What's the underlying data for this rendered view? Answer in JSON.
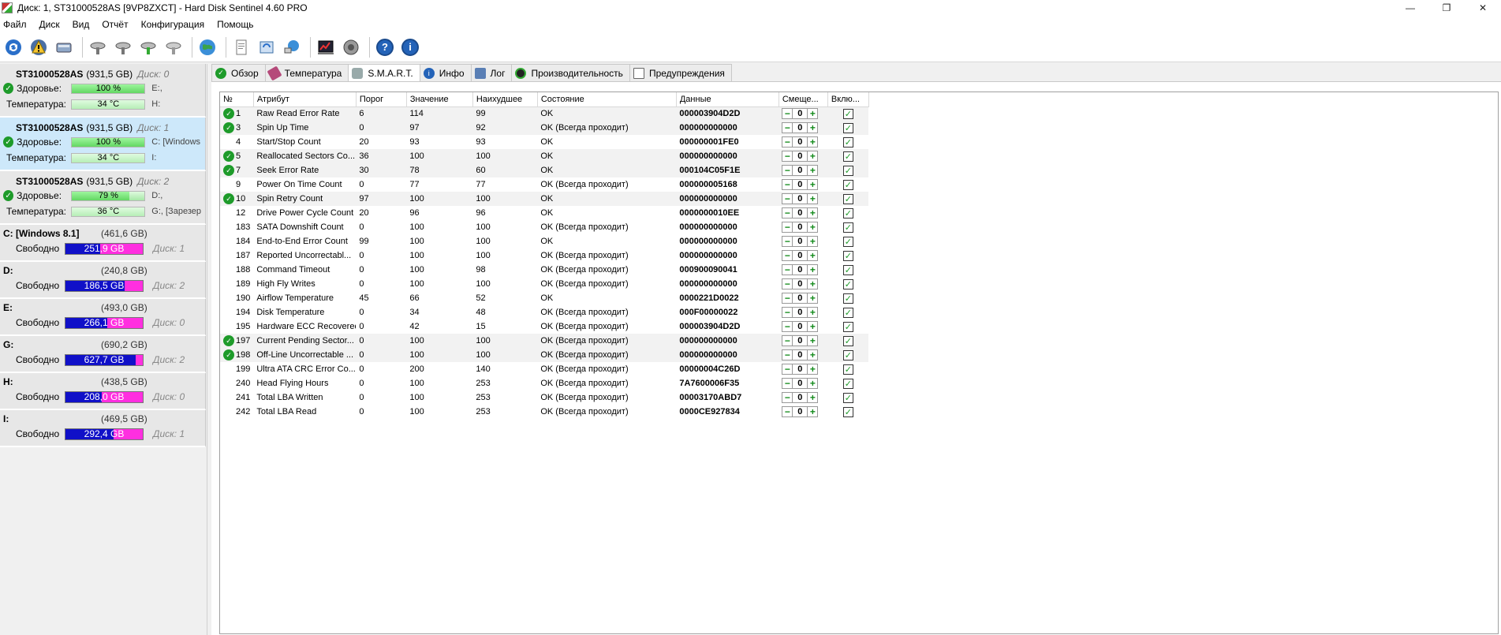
{
  "window": {
    "title": "Диск: 1, ST31000528AS [9VP8ZXCT]  -  Hard Disk Sentinel 4.60 PRO",
    "minimize": "—",
    "restore": "❐",
    "close": "✕"
  },
  "menu": [
    "Файл",
    "Диск",
    "Вид",
    "Отчёт",
    "Конфигурация",
    "Помощь"
  ],
  "toolbar": {
    "icons": [
      "refresh-icon",
      "alert-icon",
      "disk-icon",
      "disk-test-icon",
      "disk-test-icon",
      "disk-test-icon",
      "disk-test-icon",
      "globe-icon",
      "report-icon",
      "send-icon",
      "network-icon",
      "benchmark-icon",
      "sound-icon",
      "help-icon",
      "info-icon"
    ],
    "help_glyph": "?",
    "info_glyph": "i"
  },
  "disks": [
    {
      "model": "ST31000528AS",
      "capacity": "(931,5 GB)",
      "disk_no": "Диск: 0",
      "health_label": "Здоровье:",
      "health": "100 %",
      "health_value": 100,
      "vol1": "E:,",
      "temp_label": "Температура:",
      "temp": "34 °C",
      "vol2": "H:"
    },
    {
      "model": "ST31000528AS",
      "capacity": "(931,5 GB)",
      "disk_no": "Диск: 1",
      "health_label": "Здоровье:",
      "health": "100 %",
      "health_value": 100,
      "vol1": "C: [Windows",
      "temp_label": "Температура:",
      "temp": "34 °C",
      "vol2": "I:"
    },
    {
      "model": "ST31000528AS",
      "capacity": "(931,5 GB)",
      "disk_no": "Диск: 2",
      "health_label": "Здоровье:",
      "health": "79 %",
      "health_value": 79,
      "vol1": "D:,",
      "temp_label": "Температура:",
      "temp": "36 °C",
      "vol2": "G:, [Зарезер"
    }
  ],
  "volumes": [
    {
      "letter": "C: [Windows 8.1]",
      "size": "(461,6 GB)",
      "free_label": "Свободно",
      "free": "251,9 GB",
      "free_fraction": 0.55,
      "disk": "Диск: 1"
    },
    {
      "letter": "D:",
      "size": "(240,8 GB)",
      "free_label": "Свободно",
      "free": "186,5 GB",
      "free_fraction": 0.23,
      "disk": "Диск: 2"
    },
    {
      "letter": "E:",
      "size": "(493,0 GB)",
      "free_label": "Свободно",
      "free": "266,1 GB",
      "free_fraction": 0.46,
      "disk": "Диск: 0"
    },
    {
      "letter": "G:",
      "size": "(690,2 GB)",
      "free_label": "Свободно",
      "free": "627,7 GB",
      "free_fraction": 0.09,
      "disk": "Диск: 2"
    },
    {
      "letter": "H:",
      "size": "(438,5 GB)",
      "free_label": "Свободно",
      "free": "208,0 GB",
      "free_fraction": 0.53,
      "disk": "Диск: 0"
    },
    {
      "letter": "I:",
      "size": "(469,5 GB)",
      "free_label": "Свободно",
      "free": "292,4 GB",
      "free_fraction": 0.38,
      "disk": "Диск: 1"
    }
  ],
  "tabs": [
    {
      "label": "Обзор",
      "icon": "ok-check-icon",
      "active": false
    },
    {
      "label": "Температура",
      "icon": "thermometer-icon",
      "active": false
    },
    {
      "label": "S.M.A.R.T.",
      "icon": "disk-icon",
      "active": true
    },
    {
      "label": "Инфо",
      "icon": "info-icon",
      "active": false
    },
    {
      "label": "Лог",
      "icon": "log-icon",
      "active": false
    },
    {
      "label": "Производительность",
      "icon": "performance-icon",
      "active": false
    },
    {
      "label": "Предупреждения",
      "icon": "warning-doc-icon",
      "active": false
    }
  ],
  "smart": {
    "headers": [
      "№",
      "Атрибут",
      "Порог",
      "Значение",
      "Наихудшее",
      "Состояние",
      "Данные",
      "Смеще...",
      "Вклю..."
    ],
    "rows": [
      {
        "ok": true,
        "id": "1",
        "attr": "Raw Read Error Rate",
        "thr": "6",
        "val": "114",
        "worst": "99",
        "state": "OK",
        "data": "000003904D2D",
        "offset": "0"
      },
      {
        "ok": true,
        "id": "3",
        "attr": "Spin Up Time",
        "thr": "0",
        "val": "97",
        "worst": "92",
        "state": "OK (Всегда проходит)",
        "data": "000000000000",
        "offset": "0"
      },
      {
        "ok": false,
        "id": "4",
        "attr": "Start/Stop Count",
        "thr": "20",
        "val": "93",
        "worst": "93",
        "state": "OK",
        "data": "000000001FE0",
        "offset": "0"
      },
      {
        "ok": true,
        "id": "5",
        "attr": "Reallocated Sectors Co...",
        "thr": "36",
        "val": "100",
        "worst": "100",
        "state": "OK",
        "data": "000000000000",
        "offset": "0"
      },
      {
        "ok": true,
        "id": "7",
        "attr": "Seek Error Rate",
        "thr": "30",
        "val": "78",
        "worst": "60",
        "state": "OK",
        "data": "000104C05F1E",
        "offset": "0"
      },
      {
        "ok": false,
        "id": "9",
        "attr": "Power On Time Count",
        "thr": "0",
        "val": "77",
        "worst": "77",
        "state": "OK (Всегда проходит)",
        "data": "000000005168",
        "offset": "0"
      },
      {
        "ok": true,
        "id": "10",
        "attr": "Spin Retry Count",
        "thr": "97",
        "val": "100",
        "worst": "100",
        "state": "OK",
        "data": "000000000000",
        "offset": "0"
      },
      {
        "ok": false,
        "id": "12",
        "attr": "Drive Power Cycle Count",
        "thr": "20",
        "val": "96",
        "worst": "96",
        "state": "OK",
        "data": "0000000010EE",
        "offset": "0"
      },
      {
        "ok": false,
        "id": "183",
        "attr": "SATA Downshift Count",
        "thr": "0",
        "val": "100",
        "worst": "100",
        "state": "OK (Всегда проходит)",
        "data": "000000000000",
        "offset": "0"
      },
      {
        "ok": false,
        "id": "184",
        "attr": "End-to-End Error Count",
        "thr": "99",
        "val": "100",
        "worst": "100",
        "state": "OK",
        "data": "000000000000",
        "offset": "0"
      },
      {
        "ok": false,
        "id": "187",
        "attr": "Reported Uncorrectabl...",
        "thr": "0",
        "val": "100",
        "worst": "100",
        "state": "OK (Всегда проходит)",
        "data": "000000000000",
        "offset": "0"
      },
      {
        "ok": false,
        "id": "188",
        "attr": "Command Timeout",
        "thr": "0",
        "val": "100",
        "worst": "98",
        "state": "OK (Всегда проходит)",
        "data": "000900090041",
        "offset": "0"
      },
      {
        "ok": false,
        "id": "189",
        "attr": "High Fly Writes",
        "thr": "0",
        "val": "100",
        "worst": "100",
        "state": "OK (Всегда проходит)",
        "data": "000000000000",
        "offset": "0"
      },
      {
        "ok": false,
        "id": "190",
        "attr": "Airflow Temperature",
        "thr": "45",
        "val": "66",
        "worst": "52",
        "state": "OK",
        "data": "0000221D0022",
        "offset": "0"
      },
      {
        "ok": false,
        "id": "194",
        "attr": "Disk Temperature",
        "thr": "0",
        "val": "34",
        "worst": "48",
        "state": "OK (Всегда проходит)",
        "data": "000F00000022",
        "offset": "0"
      },
      {
        "ok": false,
        "id": "195",
        "attr": "Hardware ECC Recovered",
        "thr": "0",
        "val": "42",
        "worst": "15",
        "state": "OK (Всегда проходит)",
        "data": "000003904D2D",
        "offset": "0"
      },
      {
        "ok": true,
        "id": "197",
        "attr": "Current Pending Sector...",
        "thr": "0",
        "val": "100",
        "worst": "100",
        "state": "OK (Всегда проходит)",
        "data": "000000000000",
        "offset": "0"
      },
      {
        "ok": true,
        "id": "198",
        "attr": "Off-Line Uncorrectable ...",
        "thr": "0",
        "val": "100",
        "worst": "100",
        "state": "OK (Всегда проходит)",
        "data": "000000000000",
        "offset": "0"
      },
      {
        "ok": false,
        "id": "199",
        "attr": "Ultra ATA CRC Error Co...",
        "thr": "0",
        "val": "200",
        "worst": "140",
        "state": "OK (Всегда проходит)",
        "data": "00000004C26D",
        "offset": "0"
      },
      {
        "ok": false,
        "id": "240",
        "attr": "Head Flying Hours",
        "thr": "0",
        "val": "100",
        "worst": "253",
        "state": "OK (Всегда проходит)",
        "data": "7A7600006F35",
        "offset": "0"
      },
      {
        "ok": false,
        "id": "241",
        "attr": "Total LBA Written",
        "thr": "0",
        "val": "100",
        "worst": "253",
        "state": "OK (Всегда проходит)",
        "data": "00003170ABD7",
        "offset": "0"
      },
      {
        "ok": false,
        "id": "242",
        "attr": "Total LBA Read",
        "thr": "0",
        "val": "100",
        "worst": "253",
        "state": "OK (Всегда проходит)",
        "data": "0000CE927834",
        "offset": "0"
      }
    ]
  },
  "colors": {
    "ok_green": "#1e9b2a",
    "used_blue": "#1010c8",
    "free_magenta": "#ff2fe0",
    "selected_disk": "#cde8fa"
  }
}
